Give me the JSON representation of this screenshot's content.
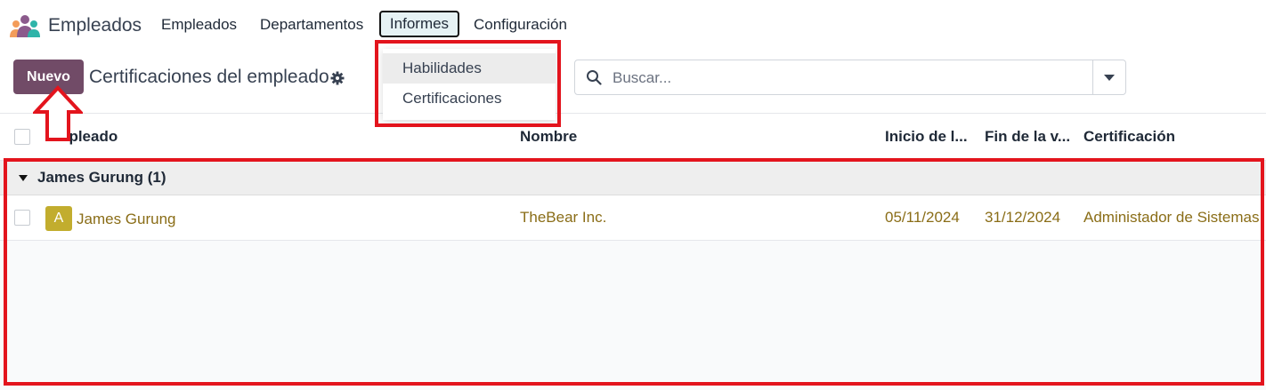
{
  "topbar": {
    "app_name": "Empleados",
    "menu": [
      "Empleados",
      "Departamentos",
      "Informes",
      "Configuración"
    ]
  },
  "reports_menu": {
    "items": [
      "Habilidades",
      "Certificaciones"
    ]
  },
  "control_panel": {
    "new_button": "Nuevo",
    "title": "Certificaciones del empleado",
    "search_placeholder": "Buscar..."
  },
  "table": {
    "columns": [
      "Empleado",
      "Nombre",
      "Inicio de l...",
      "Fin de la v...",
      "Certificación"
    ],
    "groups": [
      {
        "label": "James Gurung (1)",
        "rows": [
          {
            "avatar_letter": "A",
            "employee": "James Gurung",
            "name": "TheBear Inc.",
            "start": "05/11/2024",
            "end": "31/12/2024",
            "certification": "Administador de Sistemas"
          }
        ]
      }
    ]
  },
  "colors": {
    "primary": "#714b67",
    "link": "#8a6d17",
    "annotation": "#e3141d"
  }
}
